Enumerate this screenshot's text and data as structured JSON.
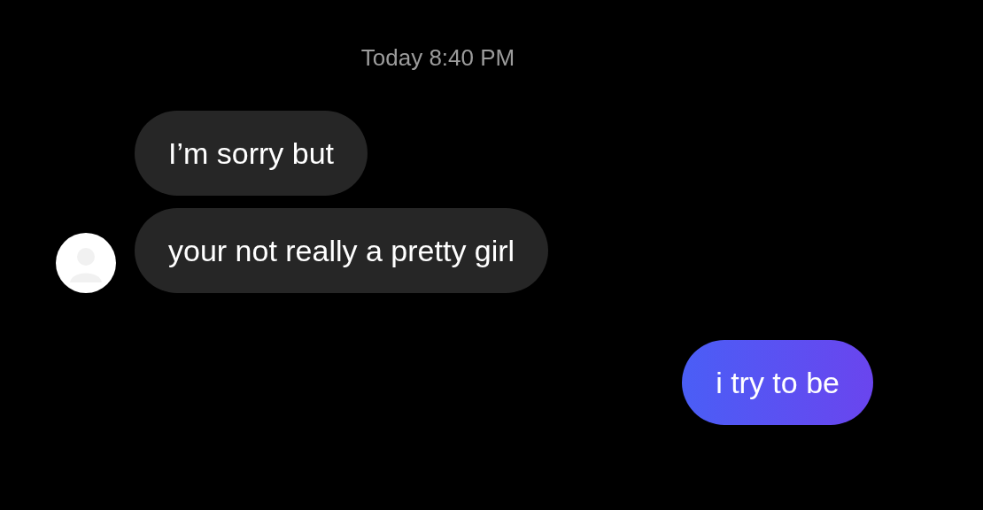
{
  "timestamp": "Today 8:40 PM",
  "messages": [
    {
      "kind": "incoming",
      "text": "I’m sorry but",
      "show_avatar": false
    },
    {
      "kind": "incoming",
      "text": "your not really a pretty girl",
      "show_avatar": true
    },
    {
      "kind": "outgoing",
      "text": "i try to be"
    }
  ]
}
